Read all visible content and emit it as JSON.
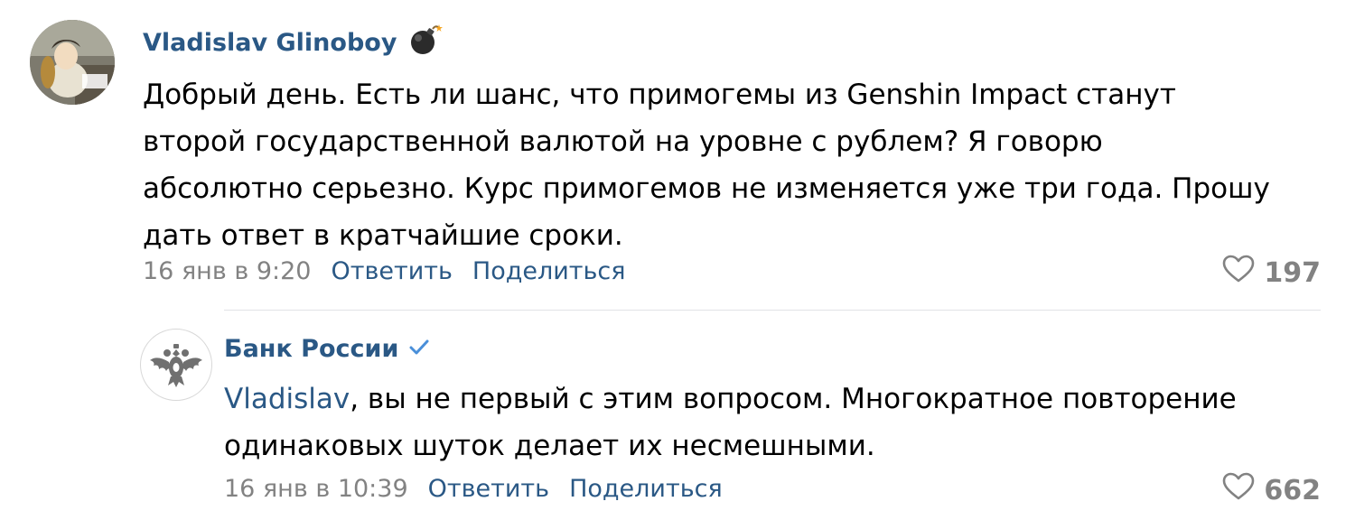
{
  "comments": [
    {
      "author": "Vladislav Glinoboy",
      "author_badge_icon": "bomb-icon",
      "avatar_icon": "user-avatar",
      "text_lines": [
        "Добрый день. Есть ли шанс, что примогемы из Genshin Impact станут",
        "второй государственной валютой на уровне с рублем? Я говорю",
        "абсолютно серьезно. Курс примогемов не изменяется уже три года. Прошу",
        "дать ответ в кратчайшие сроки."
      ],
      "timestamp": "16 янв в 9:20",
      "reply_label": "Ответить",
      "share_label": "Поделиться",
      "likes": "197"
    },
    {
      "author": "Банк России",
      "author_badge_icon": "verified-check-icon",
      "avatar_icon": "double-headed-eagle-logo",
      "mention": "Vladislav",
      "text_first_rest": ", вы не первый с этим вопросом. Многократное повторение",
      "text_second_line": "одинаковых шуток делает их несмешными.",
      "timestamp": "16 янв в 10:39",
      "reply_label": "Ответить",
      "share_label": "Поделиться",
      "likes": "662"
    }
  ],
  "colors": {
    "link": "#2a5885",
    "meta": "#828282",
    "text": "#000000",
    "divider": "#e1e3e6"
  }
}
